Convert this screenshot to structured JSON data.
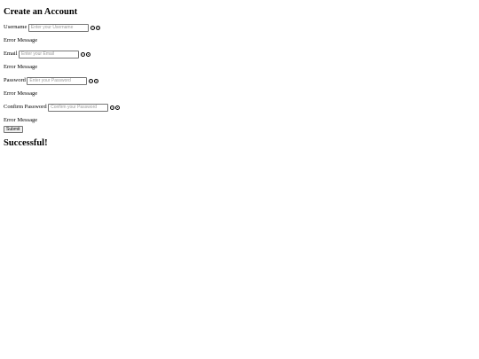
{
  "form": {
    "title": "Create an Account",
    "fields": [
      {
        "label": "Username",
        "placeholder": "Enter your Username",
        "error": "Error Message"
      },
      {
        "label": "Email",
        "placeholder": "Enter your Email",
        "error": "Error Message"
      },
      {
        "label": "Password",
        "placeholder": "Enter your Password",
        "error": "Error Message"
      },
      {
        "label": "Confirm Password",
        "placeholder": "Confirm your Password",
        "error": "Error Message"
      }
    ],
    "submit_label": "Submit",
    "success_message": "Successful!"
  },
  "icons": {
    "valid": "check-circle-icon",
    "invalid": "x-circle-icon"
  }
}
